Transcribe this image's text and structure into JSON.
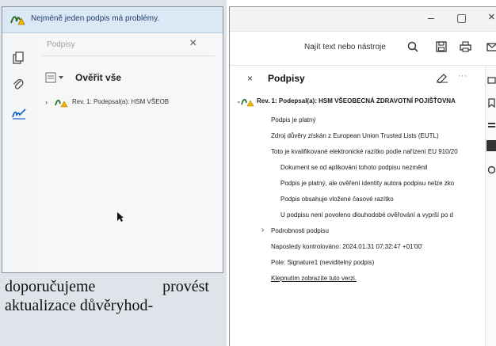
{
  "left_window": {
    "warning_text": "Nejméně jeden podpis má problémy.",
    "pane_title": "Podpisy",
    "close_label": "×",
    "validate_all_label": "Ověřit vše",
    "revision_label": "Rev. 1: Podepsal(a): HSM VŠEOB",
    "icons": [
      "signature-warning-icon",
      "pages-icon",
      "attachment-icon",
      "signature-pen-icon",
      "options-icon",
      "revision-warning-icon",
      "mouse-pointer-icon"
    ]
  },
  "body_text": {
    "line1_word1": "doporučujeme",
    "line1_word2": "provést",
    "line2": "aktualizace důvěryhod-"
  },
  "right_window": {
    "window_controls": {
      "minimize": "–",
      "maximize": "▢",
      "close": "×"
    },
    "find_text": "Najít text nebo nástroje",
    "panel_close": "×",
    "panel_title": "Podpisy",
    "more_label": "···",
    "revision_heading": "Rev. 1: Podepsal(a): HSM VŠEOBECNÁ ZDRAVOTNÍ POJIŠŤOVNA",
    "details": [
      "Podpis je platný",
      "Zdroj důvěry získán z European Union Trusted Lists (EUTL)",
      "Toto je kvalifikované elektronické razítko podle nařízení EU 910/20"
    ],
    "sub_details": [
      "Dokument se od aplikování tohoto podpisu nezměnil",
      "Podpis je platný, ale ověření identity autora podpisu nelze zko",
      "Podpis obsahuje vložené časové razítko",
      "U podpisu není povoleno dlouhodobé ověřování a vyprší po d"
    ],
    "signature_details_label": "Podrobnosti podpisu",
    "last_checked": "Naposledy kontrolováno: 2024.01.31 07:32:47 +01'00'",
    "field_label": "Pole: Signature1 (neviditelný podpis)",
    "click_to_view": "Klepnutím zobrazíte tuto verzi."
  }
}
